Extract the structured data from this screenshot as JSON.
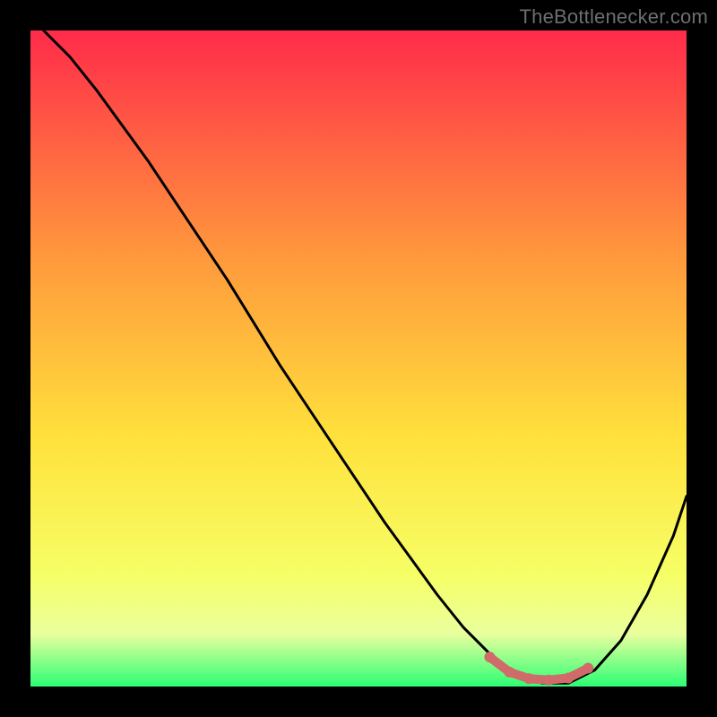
{
  "watermark": "TheBottlenecker.com",
  "gradient": {
    "top": "#ff2b4a",
    "mid_upper": "#ff9a3c",
    "mid": "#ffe13c",
    "mid_lower": "#f6ff66",
    "green": "#2bff74",
    "bottom_band_start_frac": 0.92
  },
  "chart_data": {
    "type": "line",
    "title": "",
    "xlabel": "",
    "ylabel": "",
    "xlim": [
      0,
      100
    ],
    "ylim": [
      0,
      100
    ],
    "series": [
      {
        "name": "curve",
        "color": "#000000",
        "x": [
          2,
          6,
          10,
          14,
          18,
          22,
          26,
          30,
          34,
          38,
          42,
          46,
          50,
          54,
          58,
          62,
          66,
          70,
          74,
          78,
          82,
          86,
          90,
          94,
          98,
          100
        ],
        "y": [
          100,
          96,
          91,
          85.5,
          80,
          74,
          68,
          62,
          55.5,
          49,
          43,
          37,
          31,
          25,
          19.5,
          14,
          9,
          5,
          2,
          0.5,
          0.5,
          2.5,
          7,
          14,
          23,
          29
        ]
      },
      {
        "name": "highlight",
        "color": "#d16a6a",
        "x": [
          70,
          73,
          76,
          79,
          82,
          85
        ],
        "y": [
          4.5,
          2.2,
          1.2,
          1.0,
          1.3,
          2.8
        ]
      }
    ]
  }
}
